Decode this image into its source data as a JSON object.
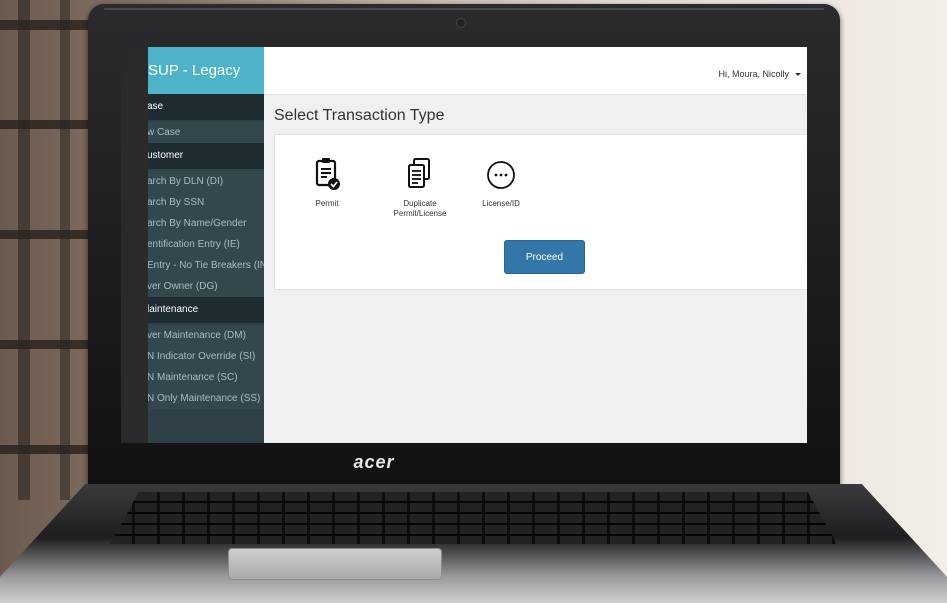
{
  "app": {
    "title": "SUP - Legacy",
    "brand": "acer"
  },
  "sidebar": {
    "sections": [
      {
        "title": "ase",
        "items": [
          "w Case"
        ]
      },
      {
        "title": "ustomer",
        "items": [
          "arch By DLN (DI)",
          "arch By SSN",
          "arch By Name/Gender",
          "entification Entry (IE)",
          "Entry - No Tie Breakers (IN)",
          "ver Owner (DG)"
        ]
      },
      {
        "title": "laintenance",
        "items": [
          "ver Maintenance (DM)",
          "N Indicator Override (SI)",
          "N Maintenance (SC)",
          "N Only Maintenance (SS)"
        ]
      }
    ]
  },
  "header": {
    "user_label": "Hi, Moura, Nicolly"
  },
  "main": {
    "title": "Select Transaction Type",
    "transactions": [
      {
        "icon": "clipboard-check-icon",
        "line1": "Permit",
        "line2": ""
      },
      {
        "icon": "duplicate-documents-icon",
        "line1": "Duplicate",
        "line2": "Permit/License"
      },
      {
        "icon": "more-options-icon",
        "line1": "License/ID",
        "line2": ""
      }
    ],
    "proceed_label": "Proceed"
  },
  "colors": {
    "brand_bar": "#4db3c9",
    "sidebar": "#2f4147",
    "sidebar_section": "#1e2c31",
    "primary_button": "#3377aa"
  }
}
